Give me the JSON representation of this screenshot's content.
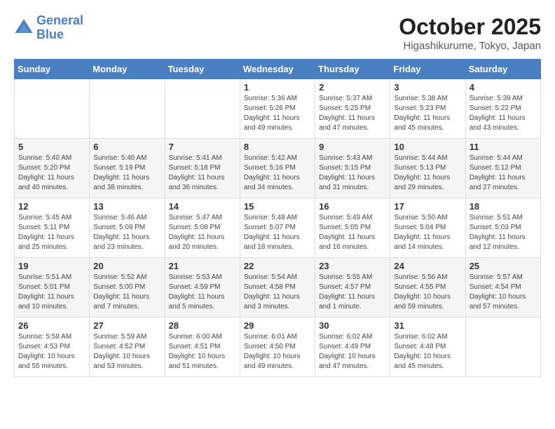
{
  "header": {
    "logo_line1": "General",
    "logo_line2": "Blue",
    "month_year": "October 2025",
    "location": "Higashikurume, Tokyo, Japan"
  },
  "weekdays": [
    "Sunday",
    "Monday",
    "Tuesday",
    "Wednesday",
    "Thursday",
    "Friday",
    "Saturday"
  ],
  "weeks": [
    [
      {
        "day": "",
        "sunrise": "",
        "sunset": "",
        "daylight": ""
      },
      {
        "day": "",
        "sunrise": "",
        "sunset": "",
        "daylight": ""
      },
      {
        "day": "",
        "sunrise": "",
        "sunset": "",
        "daylight": ""
      },
      {
        "day": "1",
        "sunrise": "Sunrise: 5:36 AM",
        "sunset": "Sunset: 5:26 PM",
        "daylight": "Daylight: 11 hours and 49 minutes."
      },
      {
        "day": "2",
        "sunrise": "Sunrise: 5:37 AM",
        "sunset": "Sunset: 5:25 PM",
        "daylight": "Daylight: 11 hours and 47 minutes."
      },
      {
        "day": "3",
        "sunrise": "Sunrise: 5:38 AM",
        "sunset": "Sunset: 5:23 PM",
        "daylight": "Daylight: 11 hours and 45 minutes."
      },
      {
        "day": "4",
        "sunrise": "Sunrise: 5:39 AM",
        "sunset": "Sunset: 5:22 PM",
        "daylight": "Daylight: 11 hours and 43 minutes."
      }
    ],
    [
      {
        "day": "5",
        "sunrise": "Sunrise: 5:40 AM",
        "sunset": "Sunset: 5:20 PM",
        "daylight": "Daylight: 11 hours and 40 minutes."
      },
      {
        "day": "6",
        "sunrise": "Sunrise: 5:40 AM",
        "sunset": "Sunset: 5:19 PM",
        "daylight": "Daylight: 11 hours and 38 minutes."
      },
      {
        "day": "7",
        "sunrise": "Sunrise: 5:41 AM",
        "sunset": "Sunset: 5:18 PM",
        "daylight": "Daylight: 11 hours and 36 minutes."
      },
      {
        "day": "8",
        "sunrise": "Sunrise: 5:42 AM",
        "sunset": "Sunset: 5:16 PM",
        "daylight": "Daylight: 11 hours and 34 minutes."
      },
      {
        "day": "9",
        "sunrise": "Sunrise: 5:43 AM",
        "sunset": "Sunset: 5:15 PM",
        "daylight": "Daylight: 11 hours and 31 minutes."
      },
      {
        "day": "10",
        "sunrise": "Sunrise: 5:44 AM",
        "sunset": "Sunset: 5:13 PM",
        "daylight": "Daylight: 11 hours and 29 minutes."
      },
      {
        "day": "11",
        "sunrise": "Sunrise: 5:44 AM",
        "sunset": "Sunset: 5:12 PM",
        "daylight": "Daylight: 11 hours and 27 minutes."
      }
    ],
    [
      {
        "day": "12",
        "sunrise": "Sunrise: 5:45 AM",
        "sunset": "Sunset: 5:11 PM",
        "daylight": "Daylight: 11 hours and 25 minutes."
      },
      {
        "day": "13",
        "sunrise": "Sunrise: 5:46 AM",
        "sunset": "Sunset: 5:09 PM",
        "daylight": "Daylight: 11 hours and 23 minutes."
      },
      {
        "day": "14",
        "sunrise": "Sunrise: 5:47 AM",
        "sunset": "Sunset: 5:08 PM",
        "daylight": "Daylight: 11 hours and 20 minutes."
      },
      {
        "day": "15",
        "sunrise": "Sunrise: 5:48 AM",
        "sunset": "Sunset: 5:07 PM",
        "daylight": "Daylight: 11 hours and 18 minutes."
      },
      {
        "day": "16",
        "sunrise": "Sunrise: 5:49 AM",
        "sunset": "Sunset: 5:05 PM",
        "daylight": "Daylight: 11 hours and 16 minutes."
      },
      {
        "day": "17",
        "sunrise": "Sunrise: 5:50 AM",
        "sunset": "Sunset: 5:04 PM",
        "daylight": "Daylight: 11 hours and 14 minutes."
      },
      {
        "day": "18",
        "sunrise": "Sunrise: 5:51 AM",
        "sunset": "Sunset: 5:03 PM",
        "daylight": "Daylight: 11 hours and 12 minutes."
      }
    ],
    [
      {
        "day": "19",
        "sunrise": "Sunrise: 5:51 AM",
        "sunset": "Sunset: 5:01 PM",
        "daylight": "Daylight: 11 hours and 10 minutes."
      },
      {
        "day": "20",
        "sunrise": "Sunrise: 5:52 AM",
        "sunset": "Sunset: 5:00 PM",
        "daylight": "Daylight: 11 hours and 7 minutes."
      },
      {
        "day": "21",
        "sunrise": "Sunrise: 5:53 AM",
        "sunset": "Sunset: 4:59 PM",
        "daylight": "Daylight: 11 hours and 5 minutes."
      },
      {
        "day": "22",
        "sunrise": "Sunrise: 5:54 AM",
        "sunset": "Sunset: 4:58 PM",
        "daylight": "Daylight: 11 hours and 3 minutes."
      },
      {
        "day": "23",
        "sunrise": "Sunrise: 5:55 AM",
        "sunset": "Sunset: 4:57 PM",
        "daylight": "Daylight: 11 hours and 1 minute."
      },
      {
        "day": "24",
        "sunrise": "Sunrise: 5:56 AM",
        "sunset": "Sunset: 4:55 PM",
        "daylight": "Daylight: 10 hours and 59 minutes."
      },
      {
        "day": "25",
        "sunrise": "Sunrise: 5:57 AM",
        "sunset": "Sunset: 4:54 PM",
        "daylight": "Daylight: 10 hours and 57 minutes."
      }
    ],
    [
      {
        "day": "26",
        "sunrise": "Sunrise: 5:58 AM",
        "sunset": "Sunset: 4:53 PM",
        "daylight": "Daylight: 10 hours and 55 minutes."
      },
      {
        "day": "27",
        "sunrise": "Sunrise: 5:59 AM",
        "sunset": "Sunset: 4:52 PM",
        "daylight": "Daylight: 10 hours and 53 minutes."
      },
      {
        "day": "28",
        "sunrise": "Sunrise: 6:00 AM",
        "sunset": "Sunset: 4:51 PM",
        "daylight": "Daylight: 10 hours and 51 minutes."
      },
      {
        "day": "29",
        "sunrise": "Sunrise: 6:01 AM",
        "sunset": "Sunset: 4:50 PM",
        "daylight": "Daylight: 10 hours and 49 minutes."
      },
      {
        "day": "30",
        "sunrise": "Sunrise: 6:02 AM",
        "sunset": "Sunset: 4:49 PM",
        "daylight": "Daylight: 10 hours and 47 minutes."
      },
      {
        "day": "31",
        "sunrise": "Sunrise: 6:02 AM",
        "sunset": "Sunset: 4:48 PM",
        "daylight": "Daylight: 10 hours and 45 minutes."
      },
      {
        "day": "",
        "sunrise": "",
        "sunset": "",
        "daylight": ""
      }
    ]
  ]
}
